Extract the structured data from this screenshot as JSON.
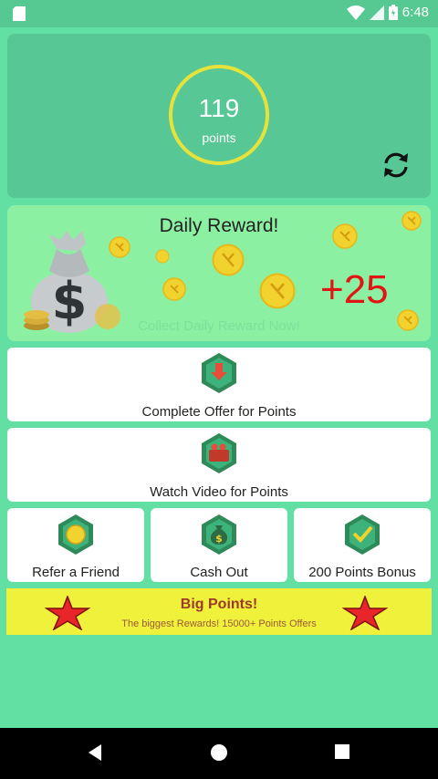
{
  "status_bar": {
    "time": "6:48"
  },
  "points": {
    "value": "119",
    "label": "points"
  },
  "daily_reward": {
    "title": "Daily Reward!",
    "amount": "+25",
    "cta": "Collect Daily Reward Now!"
  },
  "offers": {
    "complete_offer": "Complete Offer for Points",
    "watch_video": "Watch Video for Points",
    "refer_friend": "Refer a Friend",
    "cash_out": "Cash Out",
    "points_bonus": "200 Points Bonus"
  },
  "banner": {
    "title": "Big Points!",
    "subtitle": "The biggest Rewards! 15000+ Points Offers"
  },
  "colors": {
    "background": "#62dfa3",
    "card": "#56c795",
    "daily_card": "#8cf0a3",
    "ring": "#e5e23b",
    "reward_amount": "#e01515",
    "banner": "#f0f13a"
  }
}
